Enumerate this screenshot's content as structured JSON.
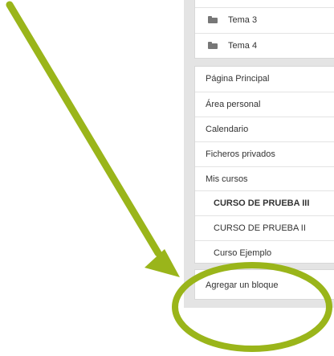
{
  "course_sections": [
    {
      "label": "Tema 3",
      "icon": "folder-icon"
    },
    {
      "label": "Tema 4",
      "icon": "folder-icon"
    }
  ],
  "navigation": {
    "items": [
      {
        "label": "Página Principal"
      },
      {
        "label": "Área personal"
      },
      {
        "label": "Calendario"
      },
      {
        "label": "Ficheros privados"
      },
      {
        "label": "Mis cursos"
      },
      {
        "label": "CURSO DE PRUEBA III"
      },
      {
        "label": "CURSO DE PRUEBA II"
      },
      {
        "label": "Curso Ejemplo"
      }
    ]
  },
  "add_block": {
    "label": "Agregar un bloque"
  },
  "annotation": {
    "arrow_color": "#9ab51a",
    "circle_color": "#9ab51a"
  }
}
